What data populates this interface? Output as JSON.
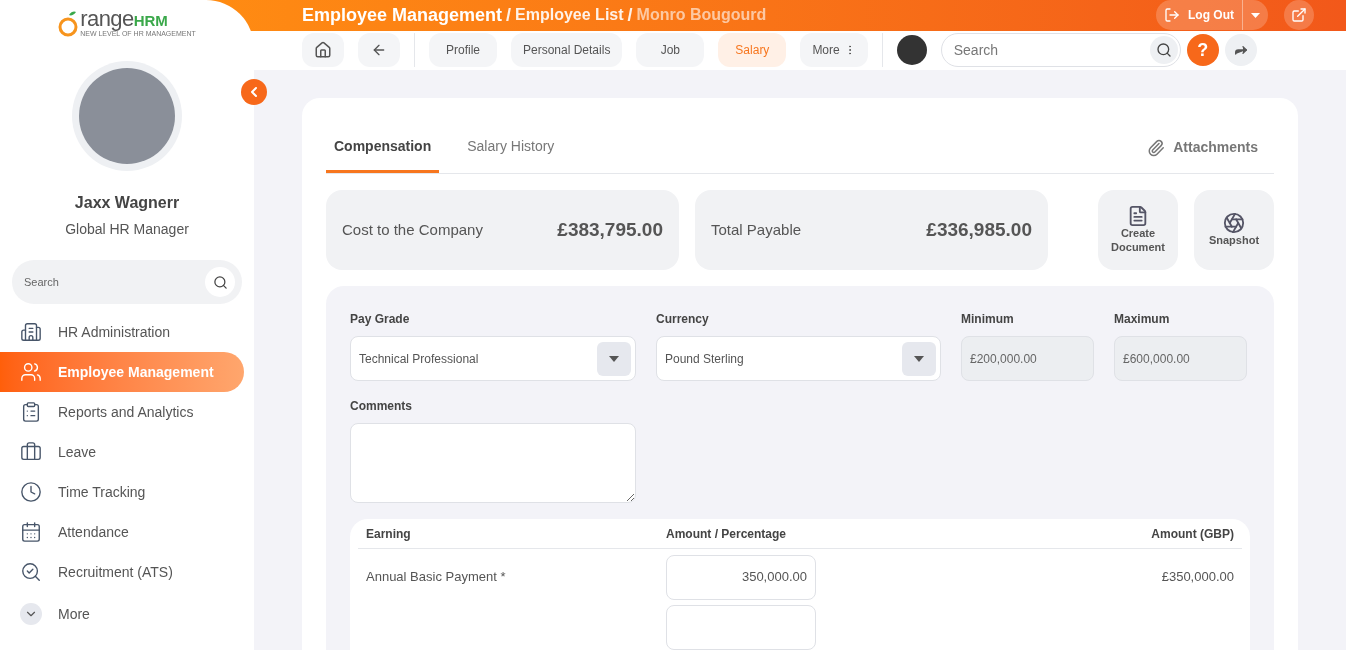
{
  "logo": {
    "word": "range",
    "brand": "HRM",
    "tagline": "NEW LEVEL OF HR MANAGEMENT"
  },
  "user": {
    "name": "Jaxx Wagnerr",
    "role": "Global HR Manager"
  },
  "sidebar": {
    "search": {
      "placeholder": "Search"
    },
    "items": [
      {
        "label": "HR Administration",
        "selected": false
      },
      {
        "label": "Employee Management",
        "selected": true
      },
      {
        "label": "Reports and Analytics",
        "selected": false
      },
      {
        "label": "Leave",
        "selected": false
      },
      {
        "label": "Time Tracking",
        "selected": false
      },
      {
        "label": "Attendance",
        "selected": false
      },
      {
        "label": "Recruitment (ATS)",
        "selected": false
      }
    ],
    "more": "More"
  },
  "breadcrumb": {
    "separator": "/",
    "items": [
      "Employee Management",
      "Employee List",
      "Monro Bougourd"
    ]
  },
  "logout": "Log Out",
  "nav_tabs": [
    {
      "label": "Profile",
      "selected": false
    },
    {
      "label": "Personal Details",
      "selected": false
    },
    {
      "label": "Job",
      "selected": false
    },
    {
      "label": "Salary",
      "selected": true
    },
    {
      "label": "More",
      "selected": false
    }
  ],
  "search": {
    "placeholder": "Search"
  },
  "help": "?",
  "tabs": [
    {
      "label": "Compensation",
      "selected": true
    },
    {
      "label": "Salary History",
      "selected": false
    }
  ],
  "attachments": "Attachments",
  "summary": [
    {
      "label": "Cost to the Company",
      "value": "£383,795.00"
    },
    {
      "label": "Total Payable",
      "value": "£336,985.00"
    }
  ],
  "actions": [
    {
      "label": "Create Document",
      "kind": "document"
    },
    {
      "label": "Snapshot",
      "kind": "snapshot"
    }
  ],
  "form": {
    "pay_grade": {
      "label": "Pay Grade",
      "value": "Technical Professional"
    },
    "currency": {
      "label": "Currency",
      "value": "Pound Sterling"
    },
    "minimum": {
      "label": "Minimum",
      "value": "£200,000.00"
    },
    "maximum": {
      "label": "Maximum",
      "value": "£600,000.00"
    },
    "comments": {
      "label": "Comments"
    }
  },
  "table": {
    "columns": [
      "Earning",
      "Amount / Percentage",
      "Amount (GBP)"
    ],
    "rows": [
      {
        "earning": "Annual Basic Payment *",
        "amount": "350,000.00",
        "total": "£350,000.00"
      }
    ]
  }
}
